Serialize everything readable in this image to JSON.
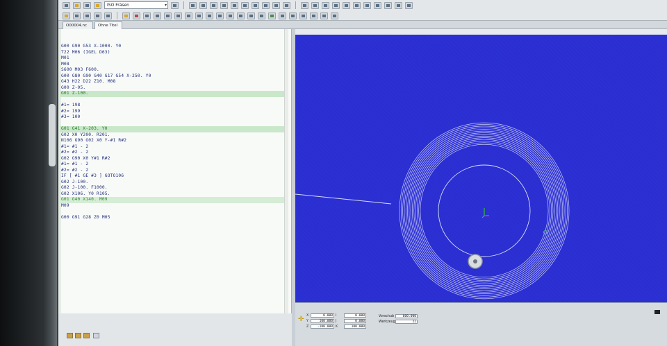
{
  "toolbar": {
    "machine": "ISO Fräsen"
  },
  "tabs": [
    {
      "label": "O00004.nc"
    },
    {
      "label": "Ohne Titel *"
    }
  ],
  "editor": {
    "lines": [
      {
        "text": "G00 G90 G53 X-1000. Y0",
        "style": ""
      },
      {
        "text": "T22 M06 (IGEL D63)",
        "style": ""
      },
      {
        "text": "M01",
        "style": ""
      },
      {
        "text": "M08",
        "style": ""
      },
      {
        "text": "S600 M03 F600.",
        "style": ""
      },
      {
        "text": "G00 G80 G90 G40 G17 G54 X-250. Y0",
        "style": ""
      },
      {
        "text": "G43 H22 D22 Z10. M08",
        "style": ""
      },
      {
        "text": "G00 Z-95.",
        "style": ""
      },
      {
        "text": "G01 Z-100.",
        "style": "hl"
      },
      {
        "text": "",
        "style": ""
      },
      {
        "text": "#1= 198",
        "style": ""
      },
      {
        "text": "#2= 199",
        "style": ""
      },
      {
        "text": "#3= 100",
        "style": ""
      },
      {
        "text": "",
        "style": ""
      },
      {
        "text": "G01 G41 X-203. Y0",
        "style": "hl"
      },
      {
        "text": "G02 X0 Y200. R201.",
        "style": ""
      },
      {
        "text": "N106 G90 G02 X0 Y-#1 R#2",
        "style": ""
      },
      {
        "text": "#1= #1 - 2",
        "style": ""
      },
      {
        "text": "#2= #2 - 2",
        "style": ""
      },
      {
        "text": "G02 G90 X0 Y#1 R#2",
        "style": ""
      },
      {
        "text": "#1= #1 - 2",
        "style": ""
      },
      {
        "text": "#2= #2 - 2",
        "style": ""
      },
      {
        "text": "IF [ #1 GE #3 ] GOTO106",
        "style": ""
      },
      {
        "text": "G02 J-100.",
        "style": ""
      },
      {
        "text": "G02 J-100. F1000.",
        "style": ""
      },
      {
        "text": "G02 X106. Y0 R105.",
        "style": ""
      },
      {
        "text": "G01 G40 X140. M09",
        "style": "hl2"
      },
      {
        "text": "M09",
        "style": ""
      },
      {
        "text": "",
        "style": ""
      },
      {
        "text": "G00 G91 G28 Z0 M05",
        "style": ""
      }
    ]
  },
  "readout": {
    "axes": [
      {
        "axis": "X",
        "value": "0.000",
        "extra_label": "I",
        "extra_value": "0.000"
      },
      {
        "axis": "Y",
        "value": "100.000",
        "extra_label": "J",
        "extra_value": "0.000"
      },
      {
        "axis": "Z",
        "value": "-100.000",
        "extra_label": "K",
        "extra_value": "100.000"
      }
    ],
    "feed_label": "Vorschub",
    "feed_value": "600.000",
    "tool_label": "Werkzeug",
    "tool_value": "22"
  },
  "colors": {
    "viewport_bg": "#2b2fd2",
    "toolpath": "#d8dcf5",
    "code_text": "#1e2a78",
    "code_highlight": "#c9e7c9"
  }
}
